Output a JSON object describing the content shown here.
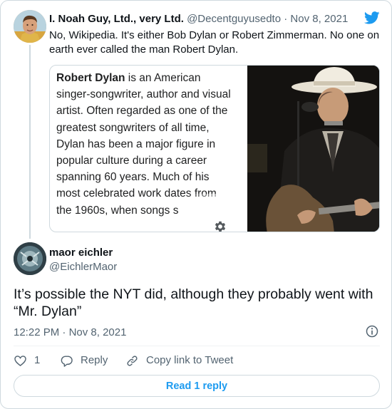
{
  "quoted_tweet": {
    "author_name": "I. Noah Guy, Ltd., very Ltd.",
    "author_handle": "@Decentguyusedto",
    "separator": "·",
    "date": "Nov 8, 2021",
    "text": "No, Wikipedia. It's either Bob Dylan or Robert Zimmerman. No one on earth ever called the man Robert Dylan."
  },
  "wiki_card": {
    "subject": "Robert Dylan",
    "body": " is an American singer-songwriter, author and visual artist. Often regarded as one of the greatest songwriters of all time, Dylan has been a major figure in popular culture during a career spanning 60 years. Much of his most celebrated work dates from the 1960s, when songs s"
  },
  "reply_tweet": {
    "author_name": "maor eichler",
    "author_handle": "@EichlerMaor",
    "text": "It’s possible the NYT did, although they probably went with “Mr. Dylan”",
    "time": "12:22 PM",
    "separator": "·",
    "date": "Nov 8, 2021"
  },
  "actions": {
    "like_count": "1",
    "reply_label": "Reply",
    "copy_label": "Copy link to Tweet"
  },
  "read_replies_label": "Read 1 reply",
  "colors": {
    "twitter_blue": "#1d9bf0",
    "border": "#cfd9de",
    "secondary_text": "#536471"
  },
  "icons": [
    "twitter-bird-icon",
    "gear-icon",
    "info-icon",
    "heart-icon",
    "reply-icon",
    "link-icon"
  ]
}
